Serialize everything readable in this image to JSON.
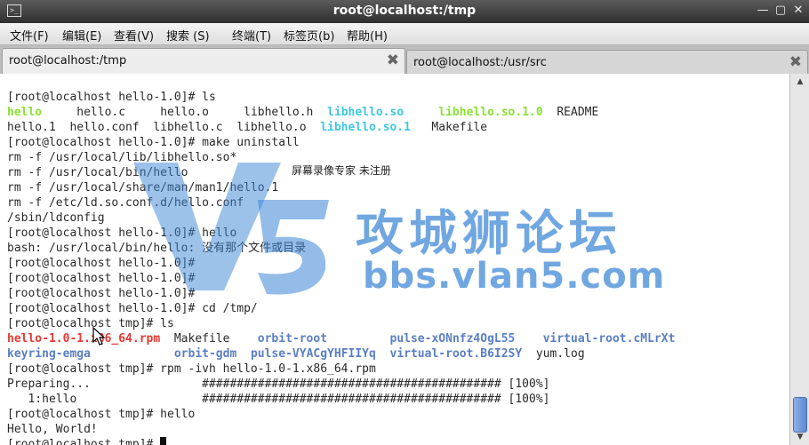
{
  "window": {
    "title": "root@localhost:/tmp"
  },
  "menu": [
    "文件(F)",
    "编辑(E)",
    "查看(V)",
    "搜索 (S)",
    "终端(T)",
    "标签页(b)",
    "帮助(H)"
  ],
  "tabs": [
    {
      "label": "root@localhost:/tmp",
      "active": true
    },
    {
      "label": "root@localhost:/usr/src",
      "active": false
    }
  ],
  "terminal_lines": [
    [
      {
        "t": "[root@localhost hello-1.0]# ls"
      }
    ],
    [
      {
        "t": "hello",
        "c": "green"
      },
      {
        "t": "     hello.c     hello.o     libhello.h  "
      },
      {
        "t": "libhello.so",
        "c": "cyan"
      },
      {
        "t": "     "
      },
      {
        "t": "libhello.so.1.0",
        "c": "green"
      },
      {
        "t": "  README"
      }
    ],
    [
      {
        "t": "hello.1  hello.conf  libhello.c  libhello.o  "
      },
      {
        "t": "libhello.so.1",
        "c": "cyan"
      },
      {
        "t": "   Makefile"
      }
    ],
    [
      {
        "t": "[root@localhost hello-1.0]# make uninstall"
      }
    ],
    [
      {
        "t": "rm -f /usr/local/lib/libhello.so*"
      }
    ],
    [
      {
        "t": "rm -f /usr/local/bin/hello"
      }
    ],
    [
      {
        "t": "rm -f /usr/local/share/man/man1/hello.1"
      }
    ],
    [
      {
        "t": "rm -f /etc/ld.so.conf.d/hello.conf"
      }
    ],
    [
      {
        "t": "/sbin/ldconfig"
      }
    ],
    [
      {
        "t": "[root@localhost hello-1.0]# hello"
      }
    ],
    [
      {
        "t": "bash: /usr/local/bin/hello: 没有那个文件或目录"
      }
    ],
    [
      {
        "t": "[root@localhost hello-1.0]#"
      }
    ],
    [
      {
        "t": "[root@localhost hello-1.0]#"
      }
    ],
    [
      {
        "t": "[root@localhost hello-1.0]#"
      }
    ],
    [
      {
        "t": "[root@localhost hello-1.0]# cd /tmp/"
      }
    ],
    [
      {
        "t": "[root@localhost tmp]# ls"
      }
    ],
    [
      {
        "t": "hello-1.0-1.x86_64.rpm",
        "c": "red"
      },
      {
        "t": "  Makefile    "
      },
      {
        "t": "orbit-root",
        "c": "blue"
      },
      {
        "t": "         "
      },
      {
        "t": "pulse-xONnfz4OgL55",
        "c": "blue"
      },
      {
        "t": "    "
      },
      {
        "t": "virtual-root.cMLrXt",
        "c": "blue"
      }
    ],
    [
      {
        "t": "keyring-emga",
        "c": "blue"
      },
      {
        "t": "            "
      },
      {
        "t": "orbit-gdm",
        "c": "blue"
      },
      {
        "t": "  "
      },
      {
        "t": "pulse-VYACgYHFIIYq",
        "c": "blue"
      },
      {
        "t": "  "
      },
      {
        "t": "virtual-root.B6I2SY",
        "c": "blue"
      },
      {
        "t": "  yum.log"
      }
    ],
    [
      {
        "t": "[root@localhost tmp]# rpm -ivh hello-1.0-1.x86_64.rpm"
      }
    ],
    [
      {
        "t": "Preparing...                ########################################### [100%]"
      }
    ],
    [
      {
        "t": "   1:hello                  ########################################### [100%]"
      }
    ],
    [
      {
        "t": "[root@localhost tmp]# hello"
      }
    ],
    [
      {
        "t": "Hello, World!"
      }
    ],
    [
      {
        "t": "[root@localhost tmp]# "
      }
    ]
  ],
  "watermark": {
    "recorder": "屏幕录像专家 未注册",
    "site_name": "攻城狮论坛",
    "site_url": "bbs.vlan5.com",
    "logo_text": "V5"
  },
  "colors": {
    "exec_green": "#8ae234",
    "symlink_cyan": "#3fc7e0",
    "archive_red": "#e53935",
    "dir_blue": "#5a7fc4",
    "watermark_blue": "#3a85d6"
  }
}
